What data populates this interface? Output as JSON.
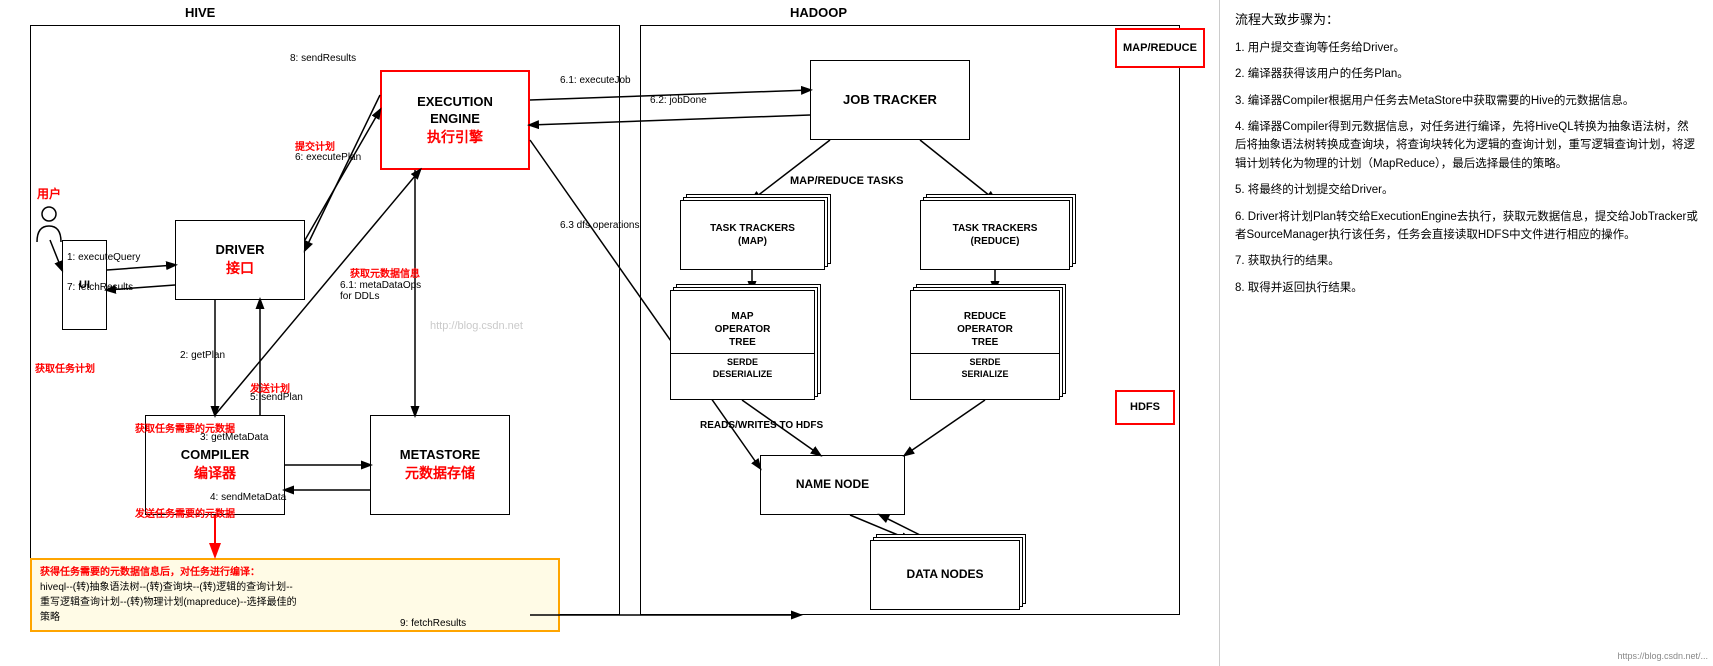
{
  "diagram": {
    "hive_label": "HIVE",
    "hadoop_label": "HADOOP",
    "user_label": "用户",
    "ui_label": "UI",
    "driver_label": "DRIVER",
    "driver_cn": "接口",
    "compiler_label": "COMPILER",
    "compiler_cn": "编译器",
    "metastore_label": "METASTORE",
    "metastore_cn": "元数据存储",
    "execution_engine_label": "EXECUTION\nENGINE",
    "execution_engine_cn": "执行引擎",
    "job_tracker_label": "JOB TRACKER",
    "map_reduce_label": "MAP/REDUCE",
    "task_trackers_map_label": "TASK TRACKERS\n(MAP)",
    "task_trackers_reduce_label": "TASK TRACKERS\n(REDUCE)",
    "map_operator_tree_label": "MAP\nOPERATOR\nTREE",
    "serde_deserialize_label": "SERDE\nDESERIALIZE",
    "reduce_operator_tree_label": "REDUCE\nOPERATOR\nTREE",
    "serde_serialize_label": "SERDE\nSERIALIZE",
    "hdfs_label": "HDFS",
    "name_node_label": "NAME NODE",
    "data_nodes_label": "DATA NODES",
    "map_reduce_tasks_label": "MAP/REDUCE TASKS",
    "reads_writes_hdfs": "READS/WRITES TO HDFS",
    "arrows": {
      "a1": "8: sendResults",
      "a2": "提交计划",
      "a3": "6: executePlan",
      "a4": "6.1: executeJob",
      "a5": "6.2: jobDone",
      "a6": "6.3 dfs operations",
      "a7": "获取元数据信息",
      "a8": "6.1: metaDataOps\nfor DDLs",
      "a9": "1: executeQuery",
      "a10": "7: fetchResults",
      "a11": "2: getPlan",
      "a12": "获取任务计划",
      "a13": "发送计划",
      "a14": "5: sendPlan",
      "a15": "获取任务需要的元数据",
      "a16": "3: getMetaData",
      "a17": "4: sendMetaData",
      "a18": "发送任务需要的元数据",
      "a19": "9: fetchResults"
    },
    "note": {
      "title": "获得任务需要的元数据信息后，对任务进行编译：",
      "line1": "hiveql--(转)抽象语法树--(转)查询块--(转)逻辑的查询计划--",
      "line2": "重写逻辑查询计划--(转)物理计划(mapreduce)--选择最佳的",
      "line3": "策略"
    },
    "watermark": "http://blog.csdn.net"
  },
  "side_panel": {
    "title": "流程大致步骤为：",
    "items": [
      "1. 用户提交查询等任务给Driver。",
      "2. 编译器获得该用户的任务Plan。",
      "3. 编译器Compiler根据用户任务去MetaStore中获取需要的Hive的元数据信息。",
      "4. 编译器Compiler得到元数据信息，对任务进行编译，先将HiveQL转换为抽象语法树，然后将抽象语法树转换成查询块，将查询块转化为逻辑的查询计划，重写逻辑查询计划，将逻辑计划转化为物理的计划（MapReduce），最后选择最佳的策略。",
      "5. 将最终的计划提交给Driver。",
      "6. Driver将计划Plan转交给ExecutionEngine去执行，获取元数据信息，提交给JobTracker或者SourceManager执行该任务，任务会直接读取HDFS中文件进行相应的操作。",
      "7. 获取执行的结果。",
      "8. 取得并返回执行结果。"
    ],
    "url": "https://blog.csdn.net/..."
  }
}
